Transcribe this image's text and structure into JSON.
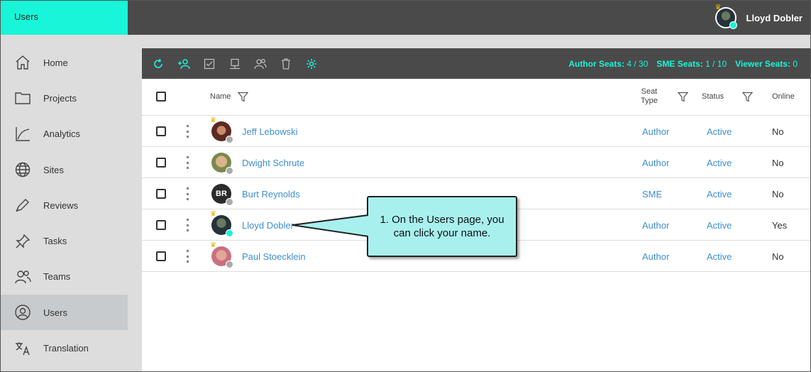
{
  "topbar": {
    "page_title": "Users",
    "current_user": "Lloyd Dobler"
  },
  "sidebar": {
    "items": [
      {
        "label": "Home",
        "icon": "home-icon"
      },
      {
        "label": "Projects",
        "icon": "folder-icon"
      },
      {
        "label": "Analytics",
        "icon": "analytics-icon"
      },
      {
        "label": "Sites",
        "icon": "globe-icon"
      },
      {
        "label": "Reviews",
        "icon": "pen-icon"
      },
      {
        "label": "Tasks",
        "icon": "pin-icon"
      },
      {
        "label": "Teams",
        "icon": "teams-icon"
      },
      {
        "label": "Users",
        "icon": "user-circle-icon",
        "active": true
      },
      {
        "label": "Translation",
        "icon": "translate-icon"
      }
    ]
  },
  "toolbar": {
    "icons": [
      "refresh-icon",
      "add-user-icon",
      "checklist-icon",
      "computer-icon",
      "group-icon",
      "trash-icon",
      "settings-icon"
    ],
    "seats": {
      "author_label": "Author Seats:",
      "author_value": "4 / 30",
      "sme_label": "SME Seats:",
      "sme_value": "1 / 10",
      "viewer_label": "Viewer Seats:",
      "viewer_value": "0"
    },
    "accent": "#19f5d8"
  },
  "table": {
    "headers": {
      "name": "Name",
      "seat_type_1": "Seat",
      "seat_type_2": "Type",
      "status": "Status",
      "online": "Online"
    },
    "rows": [
      {
        "name": "Jeff Lebowski",
        "seat": "Author",
        "status": "Active",
        "online": "No",
        "presence": "offline"
      },
      {
        "name": "Dwight Schrute",
        "seat": "Author",
        "status": "Active",
        "online": "No",
        "presence": "offline"
      },
      {
        "name": "Burt Reynolds",
        "initials": "BR",
        "seat": "SME",
        "status": "Active",
        "online": "No",
        "presence": "offline"
      },
      {
        "name": "Lloyd Dobler",
        "seat": "Author",
        "status": "Active",
        "online": "Yes",
        "presence": "online"
      },
      {
        "name": "Paul Stoecklein",
        "seat": "Author",
        "status": "Active",
        "online": "No",
        "presence": "offline"
      }
    ]
  },
  "callout": {
    "line1": "1. On the Users page, you",
    "line2": "can click your name."
  },
  "colors": {
    "link": "#3d8fce",
    "online": "#19f5d8",
    "offline": "#aaaaaa"
  }
}
